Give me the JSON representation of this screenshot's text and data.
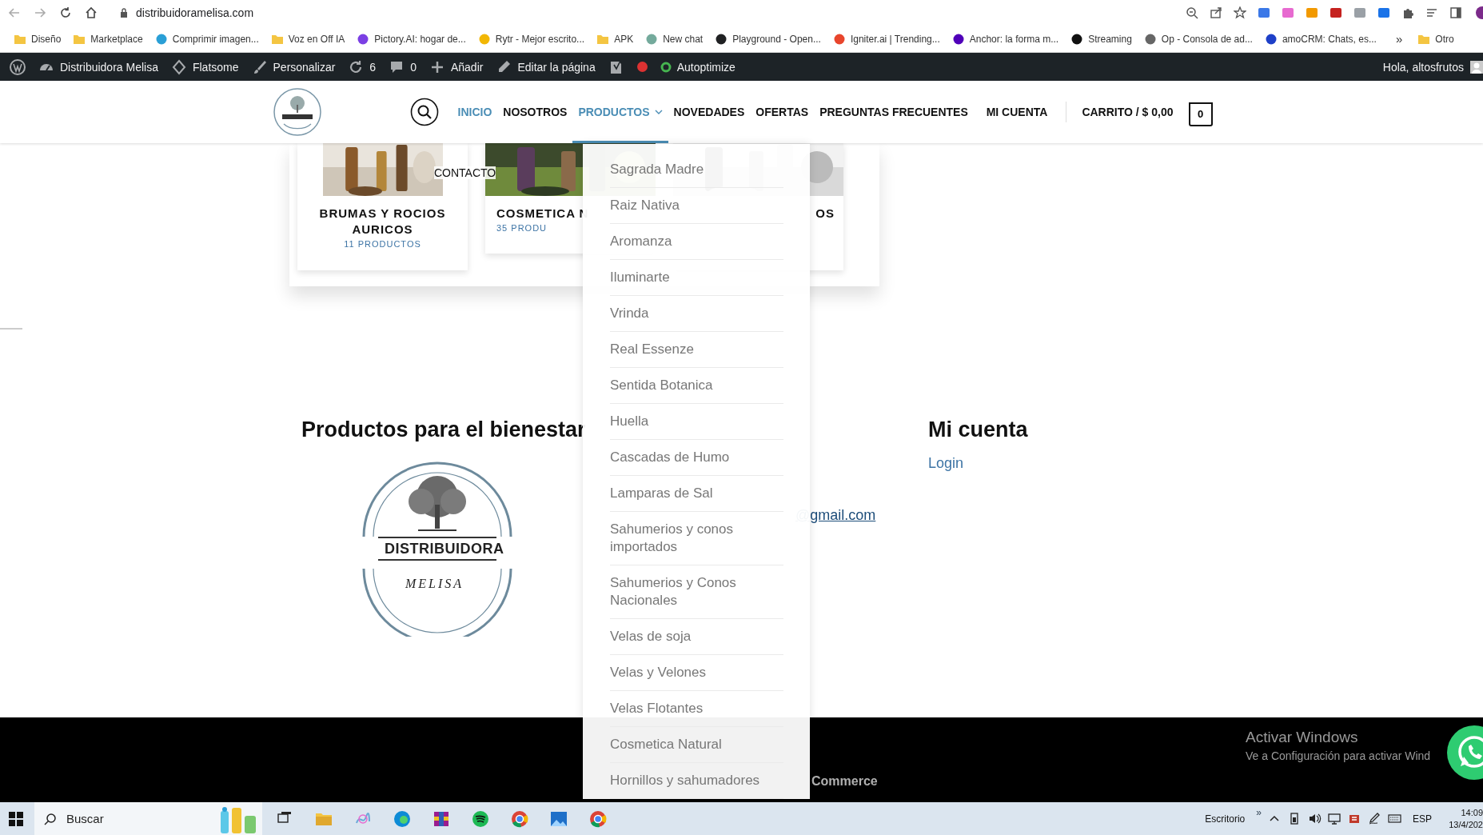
{
  "browser": {
    "url": "distribuidoramelisa.com",
    "bookmarks": [
      {
        "label": "Diseño",
        "kind": "folder"
      },
      {
        "label": "Marketplace",
        "kind": "folder"
      },
      {
        "label": "Comprimir imagen...",
        "kind": "site",
        "color": "#2a9fd6"
      },
      {
        "label": "Voz en Off IA",
        "kind": "folder"
      },
      {
        "label": "Pictory.AI: hogar de...",
        "kind": "site",
        "color": "#7b3fe4"
      },
      {
        "label": "Rytr - Mejor escrito...",
        "kind": "site",
        "color": "#f2b705"
      },
      {
        "label": "APK",
        "kind": "folder"
      },
      {
        "label": "New chat",
        "kind": "site",
        "color": "#74aa9c"
      },
      {
        "label": "Playground - Open...",
        "kind": "site",
        "color": "#202123"
      },
      {
        "label": "Igniter.ai | Trending...",
        "kind": "site",
        "color": "#e8452c"
      },
      {
        "label": "Anchor: la forma m...",
        "kind": "site",
        "color": "#5000b9"
      },
      {
        "label": "Streaming",
        "kind": "site",
        "color": "#111111"
      },
      {
        "label": "Op - Consola de ad...",
        "kind": "site",
        "color": "#666666"
      },
      {
        "label": "amoCRM: Chats, es...",
        "kind": "site",
        "color": "#1e40c8"
      }
    ],
    "more": "»",
    "other_bookmarks": "Otro"
  },
  "admin_bar": {
    "items": [
      {
        "kind": "wordpress"
      },
      {
        "kind": "dashboard",
        "label": "Distribuidora Melisa"
      },
      {
        "kind": "flatsome",
        "label": "Flatsome"
      },
      {
        "kind": "customize",
        "label": "Personalizar"
      },
      {
        "kind": "updates",
        "label": "6"
      },
      {
        "kind": "comments",
        "label": "0"
      },
      {
        "kind": "add",
        "label": "Añadir"
      },
      {
        "kind": "edit",
        "label": "Editar la página"
      },
      {
        "kind": "seo"
      },
      {
        "kind": "status",
        "color": "#dc3232"
      },
      {
        "kind": "autoptimize",
        "label": "Autoptimize"
      }
    ],
    "greeting": "Hola, altosfrutos"
  },
  "header": {
    "nav": [
      {
        "label": "INICIO",
        "selected": true,
        "expanded": false
      },
      {
        "label": "NOSOTROS",
        "selected": false,
        "expanded": false
      },
      {
        "label": "PRODUCTOS",
        "selected": true,
        "expanded": true
      },
      {
        "label": "NOVEDADES",
        "selected": false,
        "expanded": false
      },
      {
        "label": "OFERTAS",
        "selected": false,
        "expanded": false
      },
      {
        "label": "PREGUNTAS FRECUENTES",
        "selected": false,
        "expanded": false
      }
    ],
    "overflow_item": "CONTACTO",
    "account": "MI CUENTA",
    "cart": "CARRITO / $ 0,00",
    "cart_count": "0"
  },
  "categories": [
    {
      "title": "BRUMAS Y ROCIOS AURICOS",
      "count": "11 PRODUCTOS"
    },
    {
      "title": "COSMETICA N",
      "count": "35 PRODU"
    },
    {
      "title": "OS"
    }
  ],
  "dropdown": {
    "items": [
      "Sagrada Madre",
      "Raiz Nativa",
      "Aromanza",
      "Iluminarte",
      "Vrinda",
      "Real Essenze",
      "Sentida Botanica",
      "Huella",
      "Cascadas de Humo",
      "Lamparas de Sal",
      "Sahumerios y conos importados",
      "Sahumerios y Conos Nacionales",
      "Velas de soja",
      "Velas y Velones",
      "Velas Flotantes",
      "Cosmetica Natural",
      "Hornillos y sahumadores"
    ]
  },
  "widgets": {
    "heading": "Productos para el bienestar",
    "logo_lines": [
      "DISTRIBUIDORA",
      "MELISA"
    ],
    "contact_link": "@gmail.com",
    "account_heading": "Mi cuenta",
    "login": "Login"
  },
  "footer": {
    "credit": "Commerce"
  },
  "activation": {
    "title": "Activar Windows",
    "text": "Ve a Configuración para activar Wind"
  },
  "taskbar": {
    "search_placeholder": "Buscar",
    "desktop": "Escritorio",
    "overflow": "»",
    "language": "ESP",
    "time": "14:09",
    "date": "13/4/202"
  }
}
